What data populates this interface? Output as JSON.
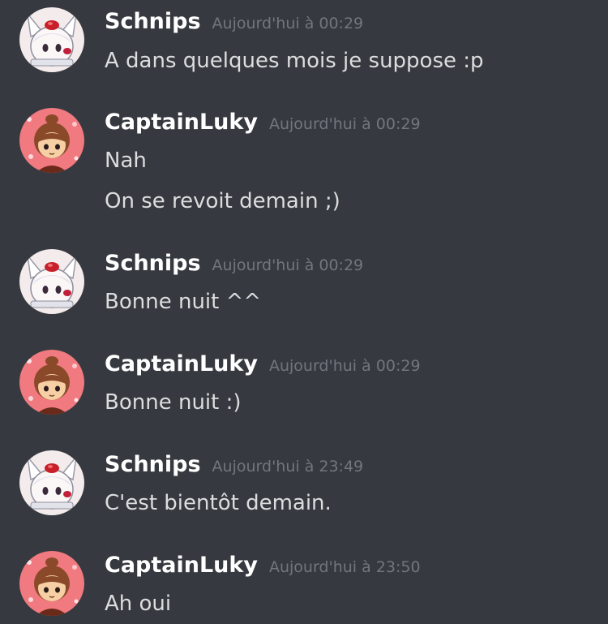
{
  "messages": [
    {
      "author": "Schnips",
      "avatar_icon": "cat-girl-avatar-icon",
      "timestamp": "Aujourd'hui à 00:29",
      "lines": [
        "A dans quelques mois je suppose :p"
      ]
    },
    {
      "author": "CaptainLuky",
      "avatar_icon": "villager-avatar-icon",
      "timestamp": "Aujourd'hui à 00:29",
      "lines": [
        "Nah",
        "On se revoit demain ;)"
      ]
    },
    {
      "author": "Schnips",
      "avatar_icon": "cat-girl-avatar-icon",
      "timestamp": "Aujourd'hui à 00:29",
      "lines": [
        "Bonne nuit ^^"
      ]
    },
    {
      "author": "CaptainLuky",
      "avatar_icon": "villager-avatar-icon",
      "timestamp": "Aujourd'hui à 00:29",
      "lines": [
        "Bonne nuit :)"
      ]
    },
    {
      "author": "Schnips",
      "avatar_icon": "cat-girl-avatar-icon",
      "timestamp": "Aujourd'hui à 23:49",
      "lines": [
        "C'est bientôt demain."
      ]
    },
    {
      "author": "CaptainLuky",
      "avatar_icon": "villager-avatar-icon",
      "timestamp": "Aujourd'hui à 23:50",
      "lines": [
        "Ah oui"
      ]
    }
  ],
  "colors": {
    "background": "#36393f",
    "username": "#ffffff",
    "timestamp": "#72767d",
    "message_text": "#dcddde"
  }
}
